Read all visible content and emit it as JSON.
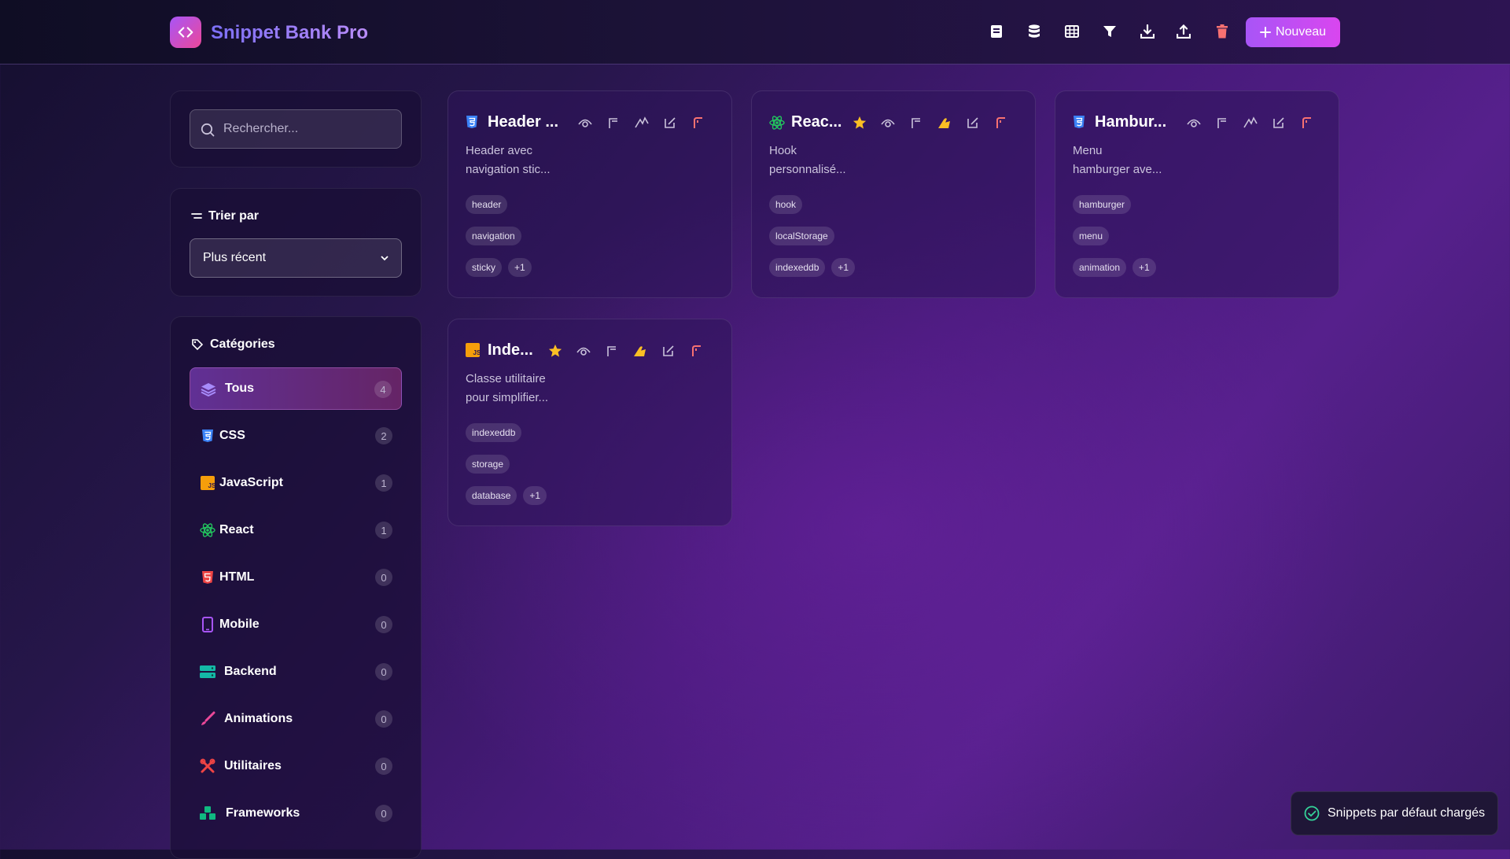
{
  "app": {
    "title": "Snippet Bank Pro"
  },
  "toolbar": {
    "new_label": "Nouveau",
    "icons": [
      "book-icon",
      "database-icon",
      "grid-icon",
      "filter-icon",
      "download-icon",
      "upload-icon",
      "trash-icon"
    ]
  },
  "search": {
    "placeholder": "Rechercher..."
  },
  "sort": {
    "title": "Trier par",
    "selected": "Plus récent"
  },
  "categories": {
    "title": "Catégories",
    "items": [
      {
        "label": "Tous",
        "count": "4"
      },
      {
        "label": "CSS",
        "count": "2"
      },
      {
        "label": "JavaScript",
        "count": "1"
      },
      {
        "label": "React",
        "count": "1"
      },
      {
        "label": "HTML",
        "count": "0"
      },
      {
        "label": "Mobile",
        "count": "0"
      },
      {
        "label": "Backend",
        "count": "0"
      },
      {
        "label": "Animations",
        "count": "0"
      },
      {
        "label": "Utilitaires",
        "count": "0"
      },
      {
        "label": "Frameworks",
        "count": "0"
      }
    ]
  },
  "cards": [
    {
      "title": "Header ...",
      "desc1": "Header avec",
      "desc2": "navigation stic...",
      "tags": [
        "header",
        "navigation",
        "sticky"
      ],
      "more": "+1",
      "favorite": false
    },
    {
      "title": "Reac...",
      "desc1": "Hook",
      "desc2": "personnalisé...",
      "tags": [
        "hook",
        "localStorage",
        "indexeddb"
      ],
      "more": "+1",
      "favorite": true
    },
    {
      "title": "Hambur...",
      "desc1": "Menu",
      "desc2": "hamburger ave...",
      "tags": [
        "hamburger",
        "menu",
        "animation"
      ],
      "more": "+1",
      "favorite": false
    },
    {
      "title": "Inde...",
      "desc1": "Classe utilitaire",
      "desc2": "pour simplifier...",
      "tags": [
        "indexeddb",
        "storage",
        "database"
      ],
      "more": "+1",
      "favorite": true
    }
  ],
  "toast": {
    "message": "Snippets par défaut chargés"
  },
  "colors": {
    "accent": "#a855f7",
    "accent2": "#d946ef",
    "danger": "#f87171",
    "star": "#fbbf24",
    "css": "#3b82f6",
    "react": "#22c55e",
    "js": "#f59e0b"
  }
}
